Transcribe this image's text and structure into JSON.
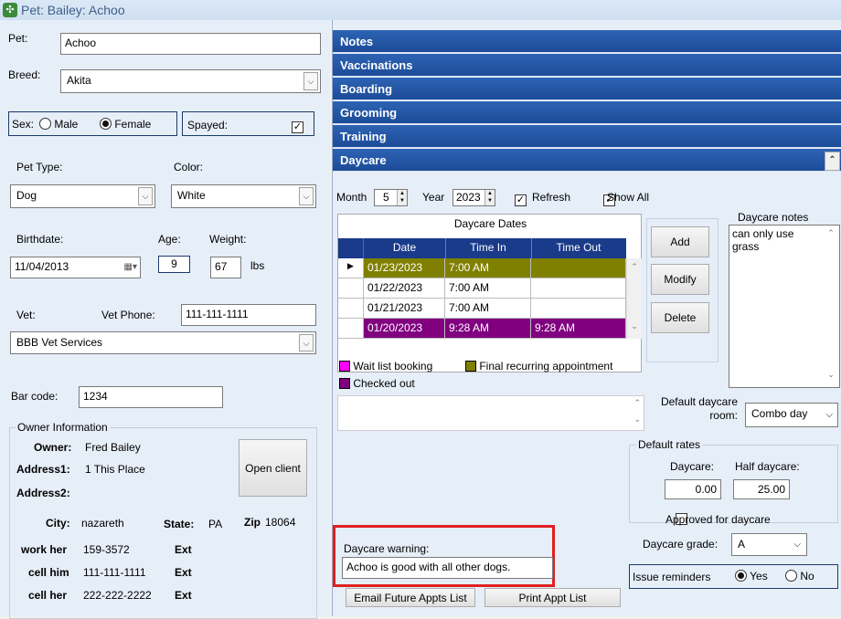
{
  "window": {
    "title": "Pet: Bailey: Achoo"
  },
  "pet": {
    "pet_label": "Pet:",
    "pet_value": "Achoo",
    "breed_label": "Breed:",
    "breed_value": "Akita",
    "sex_label": "Sex:",
    "male_label": "Male",
    "female_label": "Female",
    "sex_selected": "Female",
    "spayed_label": "Spayed:",
    "spayed_checked": true,
    "type_label": "Pet Type:",
    "type_value": "Dog",
    "color_label": "Color:",
    "color_value": "White",
    "birthdate_label": "Birthdate:",
    "birthdate_value": "11/04/2013",
    "age_label": "Age:",
    "age_value": "9",
    "weight_label": "Weight:",
    "weight_value": "67",
    "weight_unit": "lbs",
    "vet_label": "Vet:",
    "vet_phone_label": "Vet Phone:",
    "vet_phone_value": "111-111-1111",
    "vet_value": "BBB Vet Services",
    "barcode_label": "Bar code:",
    "barcode_value": "1234"
  },
  "owner": {
    "group_label": "Owner Information",
    "owner_label": "Owner:",
    "owner_value": "Fred Bailey",
    "address1_label": "Address1:",
    "address1_value": "1 This Place",
    "address2_label": "Address2:",
    "open_client_label": "Open client",
    "city_label": "City:",
    "city_value": "nazareth",
    "state_label": "State:",
    "state_value": "PA",
    "zip_label": "Zip",
    "zip_value": "18064",
    "phones": [
      {
        "label": "work her",
        "value": "159-3572",
        "ext": "Ext"
      },
      {
        "label": "cell him",
        "value": "111-111-1111",
        "ext": "Ext"
      },
      {
        "label": "cell her",
        "value": "222-222-2222",
        "ext": "Ext"
      }
    ]
  },
  "sections": [
    "Notes",
    "Vaccinations",
    "Boarding",
    "Grooming",
    "Training",
    "Daycare"
  ],
  "daycare": {
    "month_label": "Month",
    "month_value": "5",
    "year_label": "Year",
    "year_value": "2023",
    "refresh_label": "Refresh",
    "show_all_label": "Show All",
    "dates_title": "Daycare Dates",
    "columns": [
      "Date",
      "Time In",
      "Time Out"
    ],
    "rows": [
      {
        "date": "01/23/2023",
        "in": "7:00 AM",
        "out": "",
        "style": "olive"
      },
      {
        "date": "01/22/2023",
        "in": "7:00 AM",
        "out": "",
        "style": "plain"
      },
      {
        "date": "01/21/2023",
        "in": "7:00 AM",
        "out": "",
        "style": "plain"
      },
      {
        "date": "01/20/2023",
        "in": "9:28 AM",
        "out": "9:28 AM",
        "style": "purple"
      }
    ],
    "add_label": "Add",
    "modify_label": "Modify",
    "delete_label": "Delete",
    "notes_label": "Daycare notes",
    "notes_value": "can only use grass",
    "legend": [
      {
        "label": "Wait list booking",
        "color": "#ff00ff"
      },
      {
        "label": "Final recurring appointment",
        "color": "#808000"
      },
      {
        "label": "Checked out",
        "color": "#800080"
      }
    ],
    "default_room_label": "Default daycare room:",
    "default_room_value": "Combo day",
    "rates_label": "Default rates",
    "daycare_rate_label": "Daycare:",
    "daycare_rate_value": "0.00",
    "half_rate_label": "Half daycare:",
    "half_rate_value": "25.00",
    "approved_label": "Approved for daycare",
    "grade_label": "Daycare grade:",
    "grade_value": "A",
    "warning_label": "Daycare warning:",
    "warning_value": "Achoo is good with all other dogs.",
    "reminders_label": "Issue reminders",
    "yes_label": "Yes",
    "no_label": "No",
    "email_btn": "Email Future Appts List",
    "print_btn": "Print Appt List"
  },
  "colors": {
    "section_bar": "#2458a8",
    "grid_header": "#1a3a8a",
    "olive": "#808000",
    "purple": "#800080",
    "highlight": "#e02020"
  }
}
